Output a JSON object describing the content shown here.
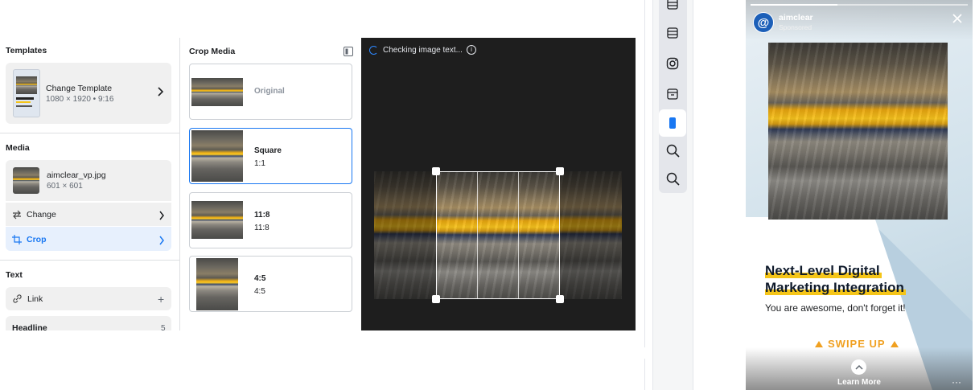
{
  "left_panel": {
    "templates_title": "Templates",
    "template": {
      "name": "Change Template",
      "size": "1080 × 1920 • 9:16"
    },
    "media_title": "Media",
    "media": {
      "filename": "aimclear_vp.jpg",
      "dimensions": "601 × 601"
    },
    "change_label": "Change",
    "crop_label": "Crop",
    "text_title": "Text",
    "link_label": "Link",
    "headline_label": "Headline",
    "headline_count": "5"
  },
  "crop_panel": {
    "title": "Crop Media",
    "options": [
      {
        "name": "Original",
        "ratio": ""
      },
      {
        "name": "Square",
        "ratio": "1:1",
        "selected": true
      },
      {
        "name": "11:8",
        "ratio": "11:8"
      },
      {
        "name": "4:5",
        "ratio": "4:5"
      }
    ]
  },
  "canvas": {
    "status": "Checking image text..."
  },
  "preview_toolbar": {
    "icons": [
      "layout-icon",
      "layout-icon",
      "instagram-icon",
      "layout-icon",
      "mobile-icon",
      "search-icon",
      "search-icon"
    ],
    "active_index": 4
  },
  "story_preview": {
    "account": "aimclear",
    "sponsored": "Sponsored",
    "headline_line1": "Next-Level Digital",
    "headline_line2": "Marketing Integration",
    "body": "You are awesome, don't forget it!",
    "swipe": "SWIPE UP",
    "cta": "Learn More",
    "colors": {
      "brand": "#1877f2",
      "highlight": "#f5c518",
      "swipe": "#f0a020"
    }
  }
}
